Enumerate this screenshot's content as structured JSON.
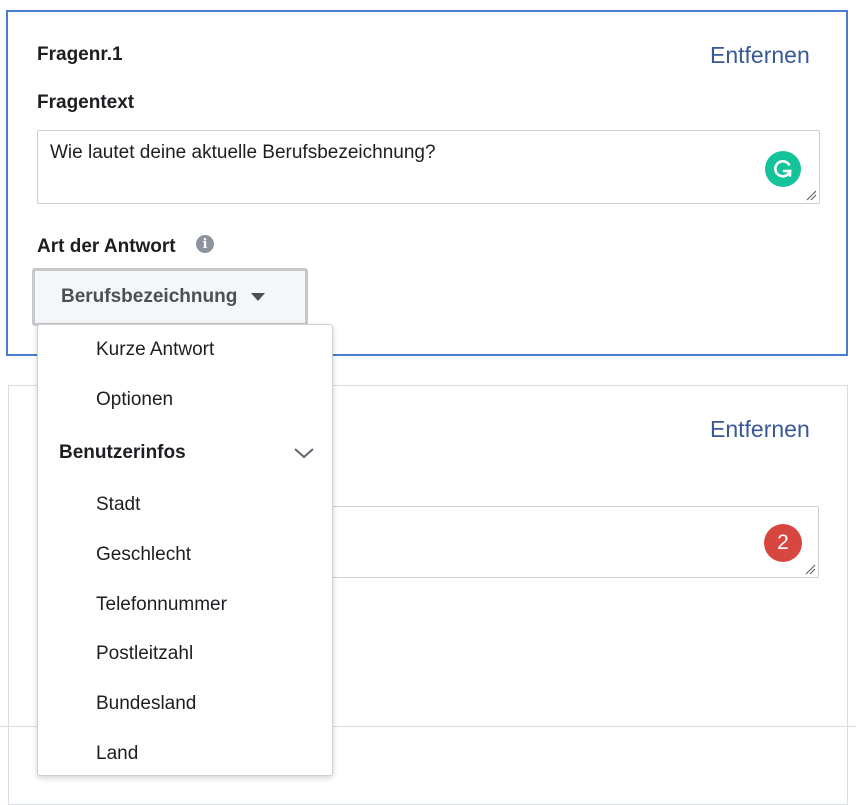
{
  "question1": {
    "number_label": "Fragenr.1",
    "remove_label": "Entfernen",
    "text_label": "Fragentext",
    "text_value": "Wie lautet deine aktuelle Berufsbezeichnung?",
    "answer_type_label": "Art der Antwort",
    "answer_type_selected": "Berufsbezeichnung",
    "grammarly_icon_text": "G"
  },
  "question2": {
    "remove_label": "Entfernen",
    "badge_count": "2"
  },
  "dropdown": {
    "items_top": [
      "Kurze Antwort",
      "Optionen"
    ],
    "group_label": "Benutzerinfos",
    "group_items": [
      "Stadt",
      "Geschlecht",
      "Telefonnummer",
      "Postleitzahl",
      "Bundesland",
      "Land"
    ]
  },
  "colors": {
    "accent_border": "#4a7bd0",
    "link": "#385898",
    "grammarly": "#15c39a",
    "badge": "#d8473f"
  }
}
